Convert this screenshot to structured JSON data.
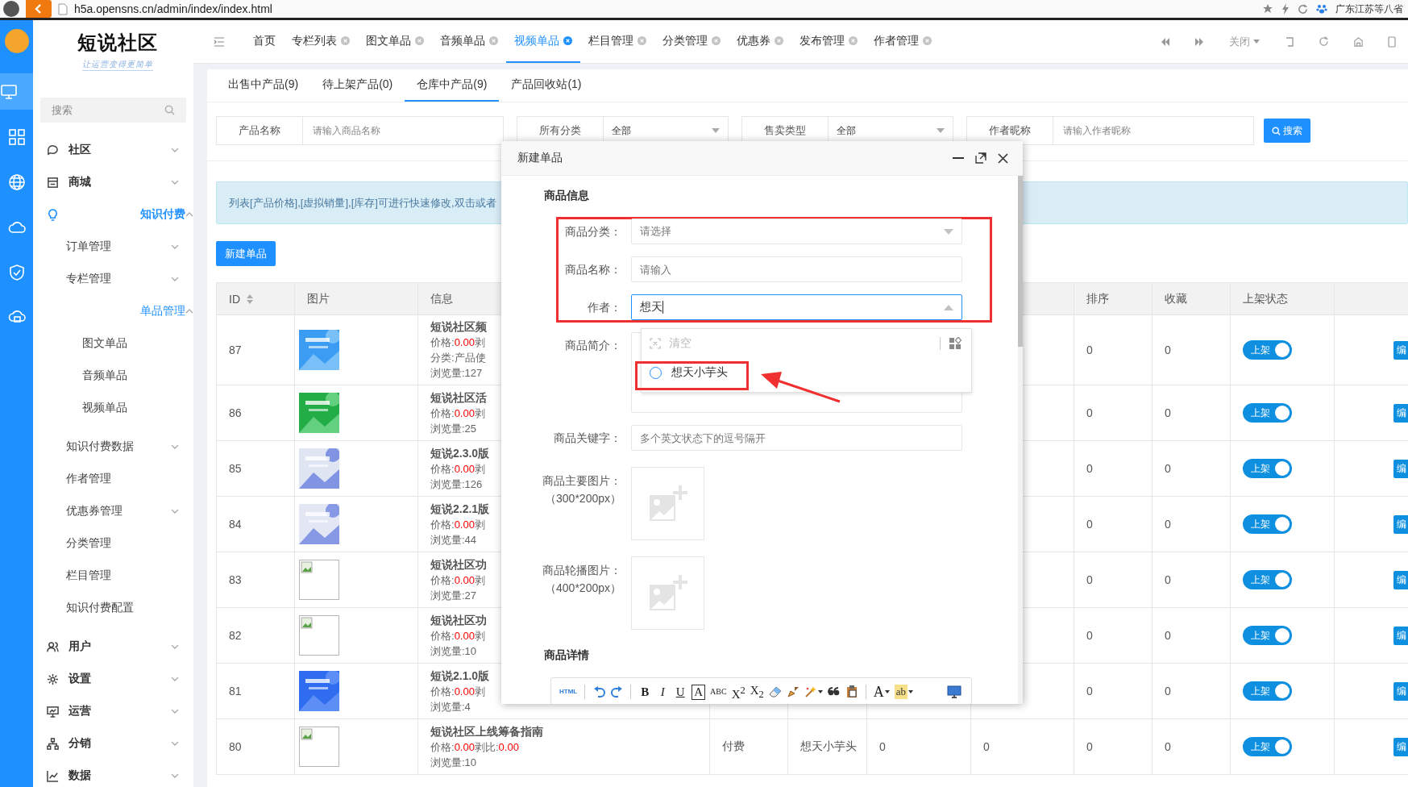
{
  "browser": {
    "url": "h5a.opensns.cn/admin/index/index.html",
    "region": "广东江苏等八省"
  },
  "rail": [
    {
      "selected": true
    },
    {
      "selected": false
    },
    {
      "selected": false
    },
    {
      "selected": false
    },
    {
      "selected": false
    },
    {
      "selected": false
    }
  ],
  "brand": {
    "name": "短说社区",
    "slogan": "让运营变得更简单"
  },
  "sidebar": {
    "search_placeholder": "搜索",
    "items": [
      {
        "label": "社区",
        "expanded": false,
        "active": false
      },
      {
        "label": "商城",
        "expanded": false,
        "active": false
      },
      {
        "label": "知识付费",
        "expanded": true,
        "active": true,
        "children": [
          {
            "label": "订单管理",
            "expanded": false,
            "active": false
          },
          {
            "label": "专栏管理",
            "expanded": false,
            "active": false
          },
          {
            "label": "单品管理",
            "expanded": true,
            "active": true,
            "children": [
              {
                "label": "图文单品",
                "active": false
              },
              {
                "label": "音频单品",
                "active": false
              },
              {
                "label": "视频单品",
                "active": false
              }
            ]
          },
          {
            "label": "知识付费数据",
            "expanded": false,
            "active": false
          },
          {
            "label": "作者管理",
            "active": false
          },
          {
            "label": "优惠券管理",
            "expanded": false,
            "active": false
          },
          {
            "label": "分类管理",
            "active": false
          },
          {
            "label": "栏目管理",
            "active": false
          },
          {
            "label": "知识付费配置",
            "active": false
          }
        ]
      },
      {
        "label": "用户",
        "expanded": false,
        "active": false
      },
      {
        "label": "设置",
        "expanded": false,
        "active": false
      },
      {
        "label": "运营",
        "expanded": false,
        "active": false
      },
      {
        "label": "分销",
        "expanded": false,
        "active": false
      },
      {
        "label": "数据",
        "expanded": false,
        "active": false
      }
    ]
  },
  "top_tabs": [
    {
      "label": "首页",
      "closable": false,
      "selected": false
    },
    {
      "label": "专栏列表",
      "closable": true,
      "selected": false
    },
    {
      "label": "图文单品",
      "closable": true,
      "selected": false
    },
    {
      "label": "音频单品",
      "closable": true,
      "selected": false
    },
    {
      "label": "视频单品",
      "closable": true,
      "selected": true
    },
    {
      "label": "栏目管理",
      "closable": true,
      "selected": false
    },
    {
      "label": "分类管理",
      "closable": true,
      "selected": false
    },
    {
      "label": "优惠券",
      "closable": true,
      "selected": false
    },
    {
      "label": "发布管理",
      "closable": true,
      "selected": false
    },
    {
      "label": "作者管理",
      "closable": true,
      "selected": false
    }
  ],
  "close_menu": "关闭",
  "sub_tabs": [
    {
      "label": "出售中产品(9)",
      "selected": false
    },
    {
      "label": "待上架产品(0)",
      "selected": false
    },
    {
      "label": "仓库中产品(9)",
      "selected": true
    },
    {
      "label": "产品回收站(1)",
      "selected": false
    }
  ],
  "filters": [
    {
      "kind": "input",
      "label": "产品名称",
      "placeholder": "请输入商品名称"
    },
    {
      "kind": "select",
      "label": "所有分类",
      "value": "全部"
    },
    {
      "kind": "select",
      "label": "售卖类型",
      "value": "全部"
    },
    {
      "kind": "input",
      "label": "作者昵称",
      "placeholder": "请输入作者昵称"
    }
  ],
  "search_button": "搜索",
  "notice": "列表[产品价格],[虚拟销量],[库存]可进行快速修改,双击或者",
  "new_button": "新建单品",
  "table": {
    "columns": [
      {
        "label": "ID",
        "sortable": true
      },
      {
        "label": "图片"
      },
      {
        "label": "信息"
      },
      {
        "label": "排序"
      },
      {
        "label": "收藏"
      },
      {
        "label": "上架状态"
      }
    ],
    "rows": [
      {
        "id": "87",
        "image": {
          "kind": "picture"
        },
        "title": "短说社区频",
        "price_line": [
          {
            "text": "价格:",
            "red": false
          },
          {
            "text": "0.00",
            "red": true
          },
          {
            "text": "剥",
            "red": false
          }
        ],
        "extra": "分类:产品使",
        "views": "浏览量:127",
        "sort": "0",
        "favorites": "0",
        "on_sale": true,
        "status_label": "上架",
        "action": "编"
      },
      {
        "id": "86",
        "image": {
          "kind": "picture"
        },
        "title": "短说社区活",
        "price_line": [
          {
            "text": "价格:",
            "red": false
          },
          {
            "text": "0.00",
            "red": true
          },
          {
            "text": "剥",
            "red": false
          }
        ],
        "views": "浏览量:25",
        "sort": "0",
        "favorites": "0",
        "on_sale": true,
        "status_label": "上架",
        "action": "编"
      },
      {
        "id": "85",
        "image": {
          "kind": "picture"
        },
        "title": "短说2.3.0版",
        "price_line": [
          {
            "text": "价格:",
            "red": false
          },
          {
            "text": "0.00",
            "red": true
          },
          {
            "text": "剥",
            "red": false
          }
        ],
        "views": "浏览量:126",
        "sort": "0",
        "favorites": "0",
        "on_sale": true,
        "status_label": "上架",
        "action": "编"
      },
      {
        "id": "84",
        "image": {
          "kind": "picture"
        },
        "title": "短说2.2.1版",
        "price_line": [
          {
            "text": "价格:",
            "red": false
          },
          {
            "text": "0.00",
            "red": true
          },
          {
            "text": "剥",
            "red": false
          }
        ],
        "views": "浏览量:44",
        "sort": "0",
        "favorites": "0",
        "on_sale": true,
        "status_label": "上架",
        "action": "编"
      },
      {
        "id": "83",
        "image": {
          "kind": "broken"
        },
        "title": "短说社区功",
        "price_line": [
          {
            "text": "价格:",
            "red": false
          },
          {
            "text": "0.00",
            "red": true
          },
          {
            "text": "剥",
            "red": false
          }
        ],
        "views": "浏览量:27",
        "sort": "0",
        "favorites": "0",
        "on_sale": true,
        "status_label": "上架",
        "action": "编"
      },
      {
        "id": "82",
        "image": {
          "kind": "broken"
        },
        "title": "短说社区功",
        "price_line": [
          {
            "text": "价格:",
            "red": false
          },
          {
            "text": "0.00",
            "red": true
          },
          {
            "text": "剥",
            "red": false
          }
        ],
        "views": "浏览量:10",
        "sort": "0",
        "favorites": "0",
        "on_sale": true,
        "status_label": "上架",
        "action": "编"
      },
      {
        "id": "81",
        "image": {
          "kind": "picture"
        },
        "title": "短说2.1.0版",
        "price_line": [
          {
            "text": "价格:",
            "red": false
          },
          {
            "text": "0.00",
            "red": true
          },
          {
            "text": "剥",
            "red": false
          }
        ],
        "views": "浏览量:4",
        "sort": "0",
        "favorites": "0",
        "on_sale": true,
        "status_label": "上架",
        "action": "编"
      },
      {
        "id": "80",
        "image": {
          "kind": "broken"
        },
        "title": "短说社区上线筹备指南",
        "price_line": [
          {
            "text": "价格:",
            "red": false
          },
          {
            "text": "0.00",
            "red": true
          },
          {
            "text": "剥比:",
            "red": false
          },
          {
            "text": "0.00",
            "red": true
          }
        ],
        "views": "浏览量:10",
        "cells": [
          "付费",
          "想天小芋头",
          "0",
          "0"
        ],
        "sort": "0",
        "favorites": "0",
        "on_sale": true,
        "status_label": "上架",
        "action": "编"
      }
    ]
  },
  "modal": {
    "title": "新建单品",
    "section_info": "商品信息",
    "category": {
      "label": "商品分类：",
      "placeholder": "请选择"
    },
    "name": {
      "label": "商品名称：",
      "placeholder": "请输入"
    },
    "author": {
      "label": "作者：",
      "value": "想天",
      "open": true
    },
    "dropdown": {
      "clear": "清空",
      "options": [
        {
          "label": "想天小芋头",
          "selected": false
        }
      ]
    },
    "intro": {
      "label": "商品简介："
    },
    "keywords": {
      "label": "商品关键字：",
      "placeholder": "多个英文状态下的逗号隔开"
    },
    "main_image": {
      "label": "商品主要图片：",
      "hint": "（300*200px）"
    },
    "carousel_image": {
      "label": "商品轮播图片：",
      "hint": "（400*200px）"
    },
    "section_detail": "商品详情",
    "editor_toolbar": [
      [
        {
          "kind": "html",
          "text": "HTML"
        }
      ],
      [
        {
          "kind": "undo"
        },
        {
          "kind": "redo"
        }
      ],
      [
        {
          "kind": "bold",
          "text": "B"
        },
        {
          "kind": "italic",
          "text": "I"
        },
        {
          "kind": "underline",
          "text": "U"
        },
        {
          "kind": "boxed",
          "text": "A"
        },
        {
          "kind": "strike",
          "text": "ABC"
        },
        {
          "kind": "sup",
          "text": "X$^{2}$"
        },
        {
          "kind": "sub",
          "text": "X$_{2}$"
        },
        {
          "kind": "eraser"
        },
        {
          "kind": "brush"
        },
        {
          "kind": "wand"
        },
        {
          "kind": "quote"
        },
        {
          "kind": "paste"
        }
      ],
      [
        {
          "kind": "fontcolor",
          "text": "A"
        },
        {
          "kind": "highlight",
          "text": "ab"
        }
      ],
      [
        {
          "kind": "preview"
        }
      ]
    ]
  }
}
